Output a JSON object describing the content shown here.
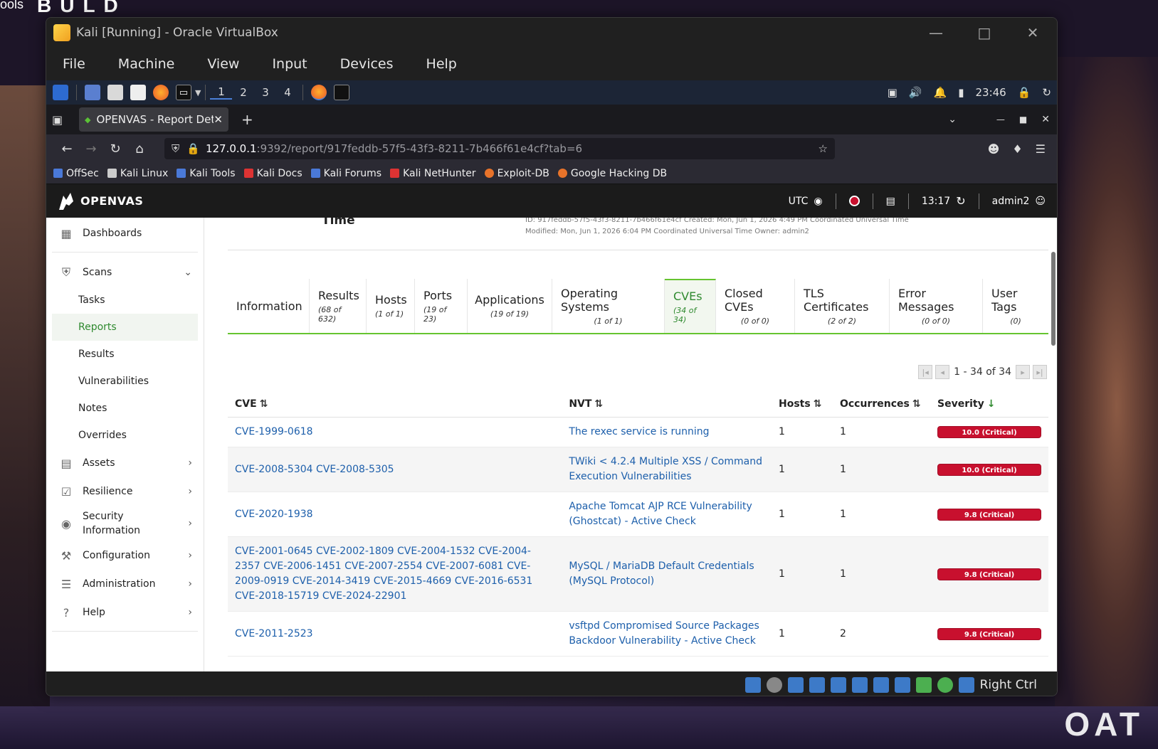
{
  "desktop": {
    "top_text": "ools",
    "brand": "BULD",
    "bottom_text": "OAT"
  },
  "vbox": {
    "title": "Kali [Running] - Oracle VirtualBox",
    "menu": [
      "File",
      "Machine",
      "View",
      "Input",
      "Devices",
      "Help"
    ],
    "status_text": "Right Ctrl"
  },
  "kali_panel": {
    "workspaces": [
      "1",
      "2",
      "3",
      "4"
    ],
    "time": "23:46"
  },
  "firefox": {
    "tab_title": "OPENVAS - Report Detail",
    "url_host": "127.0.0.1",
    "url_rest": ":9392/report/917feddb-57f5-43f3-8211-7b466f61e4cf?tab=6",
    "bookmarks": [
      "OffSec",
      "Kali Linux",
      "Kali Tools",
      "Kali Docs",
      "Kali Forums",
      "Kali NetHunter",
      "Exploit-DB",
      "Google Hacking DB"
    ]
  },
  "openvas": {
    "brand": "OPENVAS",
    "timezone": "UTC",
    "clock": "13:17",
    "user": "admin2",
    "sidebar": {
      "dashboards": "Dashboards",
      "scans": "Scans",
      "scans_sub": [
        "Tasks",
        "Reports",
        "Results",
        "Vulnerabilities",
        "Notes",
        "Overrides"
      ],
      "assets": "Assets",
      "resilience": "Resilience",
      "security_info_1": "Security",
      "security_info_2": "Information",
      "configuration": "Configuration",
      "administration": "Administration",
      "help": "Help"
    },
    "page_head": {
      "title_fragment": "Time",
      "id_line": "ID: 917feddb-57f5-43f3-8211-7b466f61e4cf     Created: Mon, Jun 1, 2026 4:49 PM Coordinated Universal Time",
      "modified_line": "Modified: Mon, Jun 1, 2026 6:04 PM Coordinated Universal Time      Owner: admin2"
    },
    "tabs": [
      {
        "label": "Information",
        "count": ""
      },
      {
        "label": "Results",
        "count": "(68 of 632)"
      },
      {
        "label": "Hosts",
        "count": "(1 of 1)"
      },
      {
        "label": "Ports",
        "count": "(19 of 23)"
      },
      {
        "label": "Applications",
        "count": "(19 of 19)"
      },
      {
        "label": "Operating Systems",
        "count": "(1 of 1)"
      },
      {
        "label": "CVEs",
        "count": "(34 of 34)"
      },
      {
        "label": "Closed CVEs",
        "count": "(0 of 0)"
      },
      {
        "label": "TLS Certificates",
        "count": "(2 of 2)"
      },
      {
        "label": "Error Messages",
        "count": "(0 of 0)"
      },
      {
        "label": "User Tags",
        "count": "(0)"
      }
    ],
    "pager": "1 - 34 of 34",
    "columns": {
      "cve": "CVE",
      "nvt": "NVT",
      "hosts": "Hosts",
      "occurrences": "Occurrences",
      "severity": "Severity"
    },
    "rows": [
      {
        "cve": "CVE-1999-0618",
        "nvt": "The rexec service is running",
        "hosts": "1",
        "occ": "1",
        "sev": "10.0 (Critical)"
      },
      {
        "cve": "CVE-2008-5304 CVE-2008-5305",
        "nvt": "TWiki < 4.2.4 Multiple XSS / Command Execution Vulnerabilities",
        "hosts": "1",
        "occ": "1",
        "sev": "10.0 (Critical)"
      },
      {
        "cve": "CVE-2020-1938",
        "nvt": "Apache Tomcat AJP RCE Vulnerability (Ghostcat) - Active Check",
        "hosts": "1",
        "occ": "1",
        "sev": "9.8 (Critical)"
      },
      {
        "cve": "CVE-2001-0645 CVE-2002-1809 CVE-2004-1532 CVE-2004-2357 CVE-2006-1451 CVE-2007-2554 CVE-2007-6081 CVE-2009-0919 CVE-2014-3419 CVE-2015-4669 CVE-2016-6531 CVE-2018-15719 CVE-2024-22901",
        "nvt": "MySQL / MariaDB Default Credentials (MySQL Protocol)",
        "hosts": "1",
        "occ": "1",
        "sev": "9.8 (Critical)"
      },
      {
        "cve": "CVE-2011-2523",
        "nvt": "vsftpd Compromised Source Packages Backdoor Vulnerability - Active Check",
        "hosts": "1",
        "occ": "2",
        "sev": "9.8 (Critical)"
      }
    ]
  }
}
